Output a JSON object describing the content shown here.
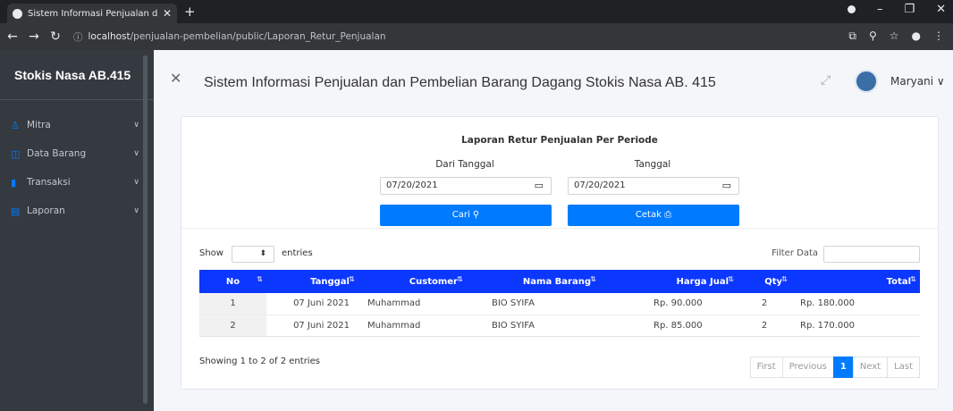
{
  "browser": {
    "tab_title": "Sistem Informasi Penjualan dan P",
    "url_host": "localhost",
    "url_path": "/penjualan-pembelian/public/Laporan_Retur_Penjualan"
  },
  "sidebar": {
    "brand": "Stokis Nasa AB.415",
    "items": [
      {
        "label": "Mitra",
        "icon": "user-icon"
      },
      {
        "label": "Data Barang",
        "icon": "box-icon"
      },
      {
        "label": "Transaksi",
        "icon": "chart-icon"
      },
      {
        "label": "Laporan",
        "icon": "report-icon"
      }
    ]
  },
  "header": {
    "title": "Sistem Informasi Penjualan dan Pembelian Barang Dagang Stokis Nasa AB. 415",
    "username": "Maryani"
  },
  "report": {
    "title": "Laporan Retur Penjualan Per Periode",
    "from_label": "Dari Tanggal",
    "to_label": "Tanggal",
    "from_value": "07/20/2021",
    "to_value": "07/20/2021",
    "search_button": "Cari",
    "print_button": "Cetak"
  },
  "table_controls": {
    "show_label": "Show",
    "entries_label": "entries",
    "filter_label": "Filter Data"
  },
  "table": {
    "columns": [
      "No",
      "Tanggal",
      "Customer",
      "Nama Barang",
      "Harga Jual",
      "Qty",
      "Total"
    ],
    "rows": [
      [
        "1",
        "07 Juni 2021",
        "Muhammad",
        "BIO SYIFA",
        "Rp. 90.000",
        "2",
        "Rp. 180.000"
      ],
      [
        "2",
        "07 Juni 2021",
        "Muhammad",
        "BIO SYIFA",
        "Rp. 85.000",
        "2",
        "Rp. 170.000"
      ]
    ]
  },
  "footer": {
    "info": "Showing 1 to 2 of 2 entries",
    "pager": [
      "First",
      "Previous",
      "1",
      "Next",
      "Last"
    ]
  },
  "colors": {
    "accent": "#007bff",
    "table_header": "#0c37ff",
    "sidebar": "#343a40"
  }
}
